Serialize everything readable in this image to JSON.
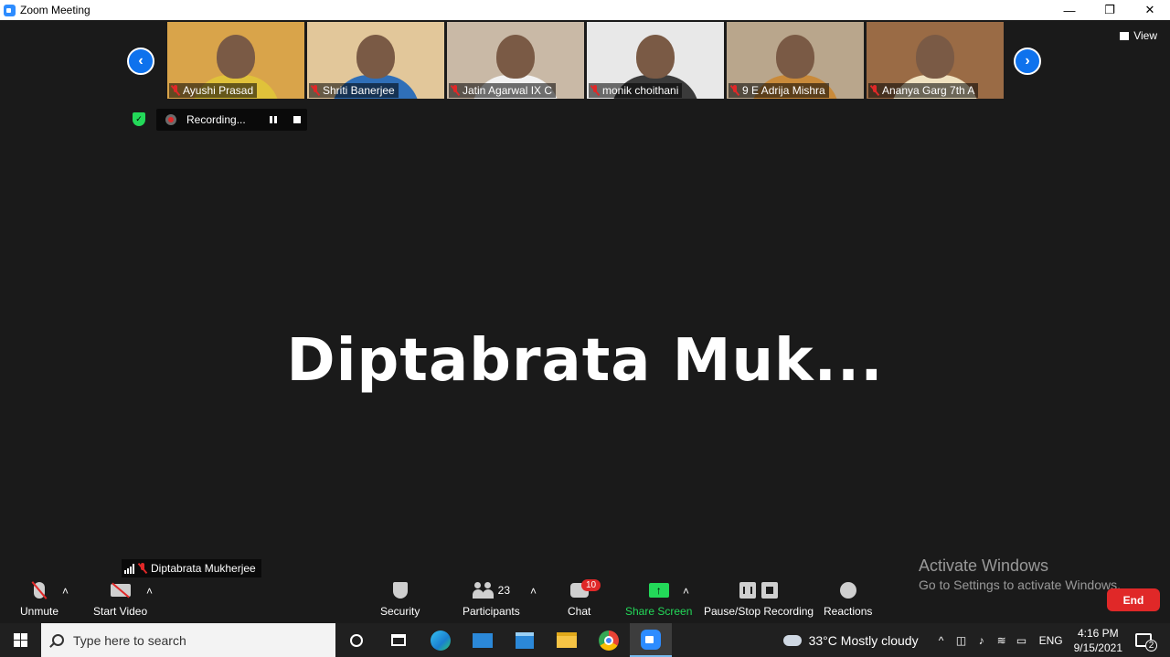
{
  "window": {
    "title": "Zoom Meeting",
    "controls": {
      "minimize": "—",
      "restore": "❐",
      "close": "✕"
    }
  },
  "gallery": {
    "prev_icon": "chevron-left-icon",
    "next_icon": "chevron-right-icon",
    "view_label": "View",
    "participants": [
      {
        "name": "Ayushi Prasad",
        "bg": "#d9a44a",
        "shirt": "#e0c23a"
      },
      {
        "name": "Shriti Banerjee",
        "bg": "#e2c79a",
        "shirt": "#2f6fb8"
      },
      {
        "name": "Jatin Agarwal IX C",
        "bg": "#c9b9a6",
        "shirt": "#f2f2f2"
      },
      {
        "name": "monik choithani",
        "bg": "#e8e8e8",
        "shirt": "#3a3a3a"
      },
      {
        "name": "9 E Adrija Mishra",
        "bg": "#b9a68c",
        "shirt": "#c98a3a"
      },
      {
        "name": "Ananya Garg 7th A",
        "bg": "#9a6b45",
        "shirt": "#f0e2c0"
      }
    ]
  },
  "recording": {
    "status": "Recording..."
  },
  "active_speaker": {
    "display": "Diptabrata  Muk...",
    "label": "Diptabrata Mukherjee"
  },
  "watermark": {
    "line1": "Activate Windows",
    "line2": "Go to Settings to activate Windows."
  },
  "toolbar": {
    "unmute": "Unmute",
    "start_video": "Start Video",
    "security": "Security",
    "participants": "Participants",
    "participants_count": "23",
    "chat": "Chat",
    "chat_badge": "10",
    "share_screen": "Share Screen",
    "pause_stop_recording": "Pause/Stop Recording",
    "reactions": "Reactions",
    "end": "End"
  },
  "taskbar": {
    "search_placeholder": "Type here to search",
    "weather": "33°C  Mostly cloudy",
    "language": "ENG",
    "time": "4:16 PM",
    "date": "9/15/2021",
    "notification_count": "2"
  },
  "colors": {
    "accent_blue": "#0e72ed",
    "share_green": "#23d959",
    "end_red": "#e02828"
  }
}
